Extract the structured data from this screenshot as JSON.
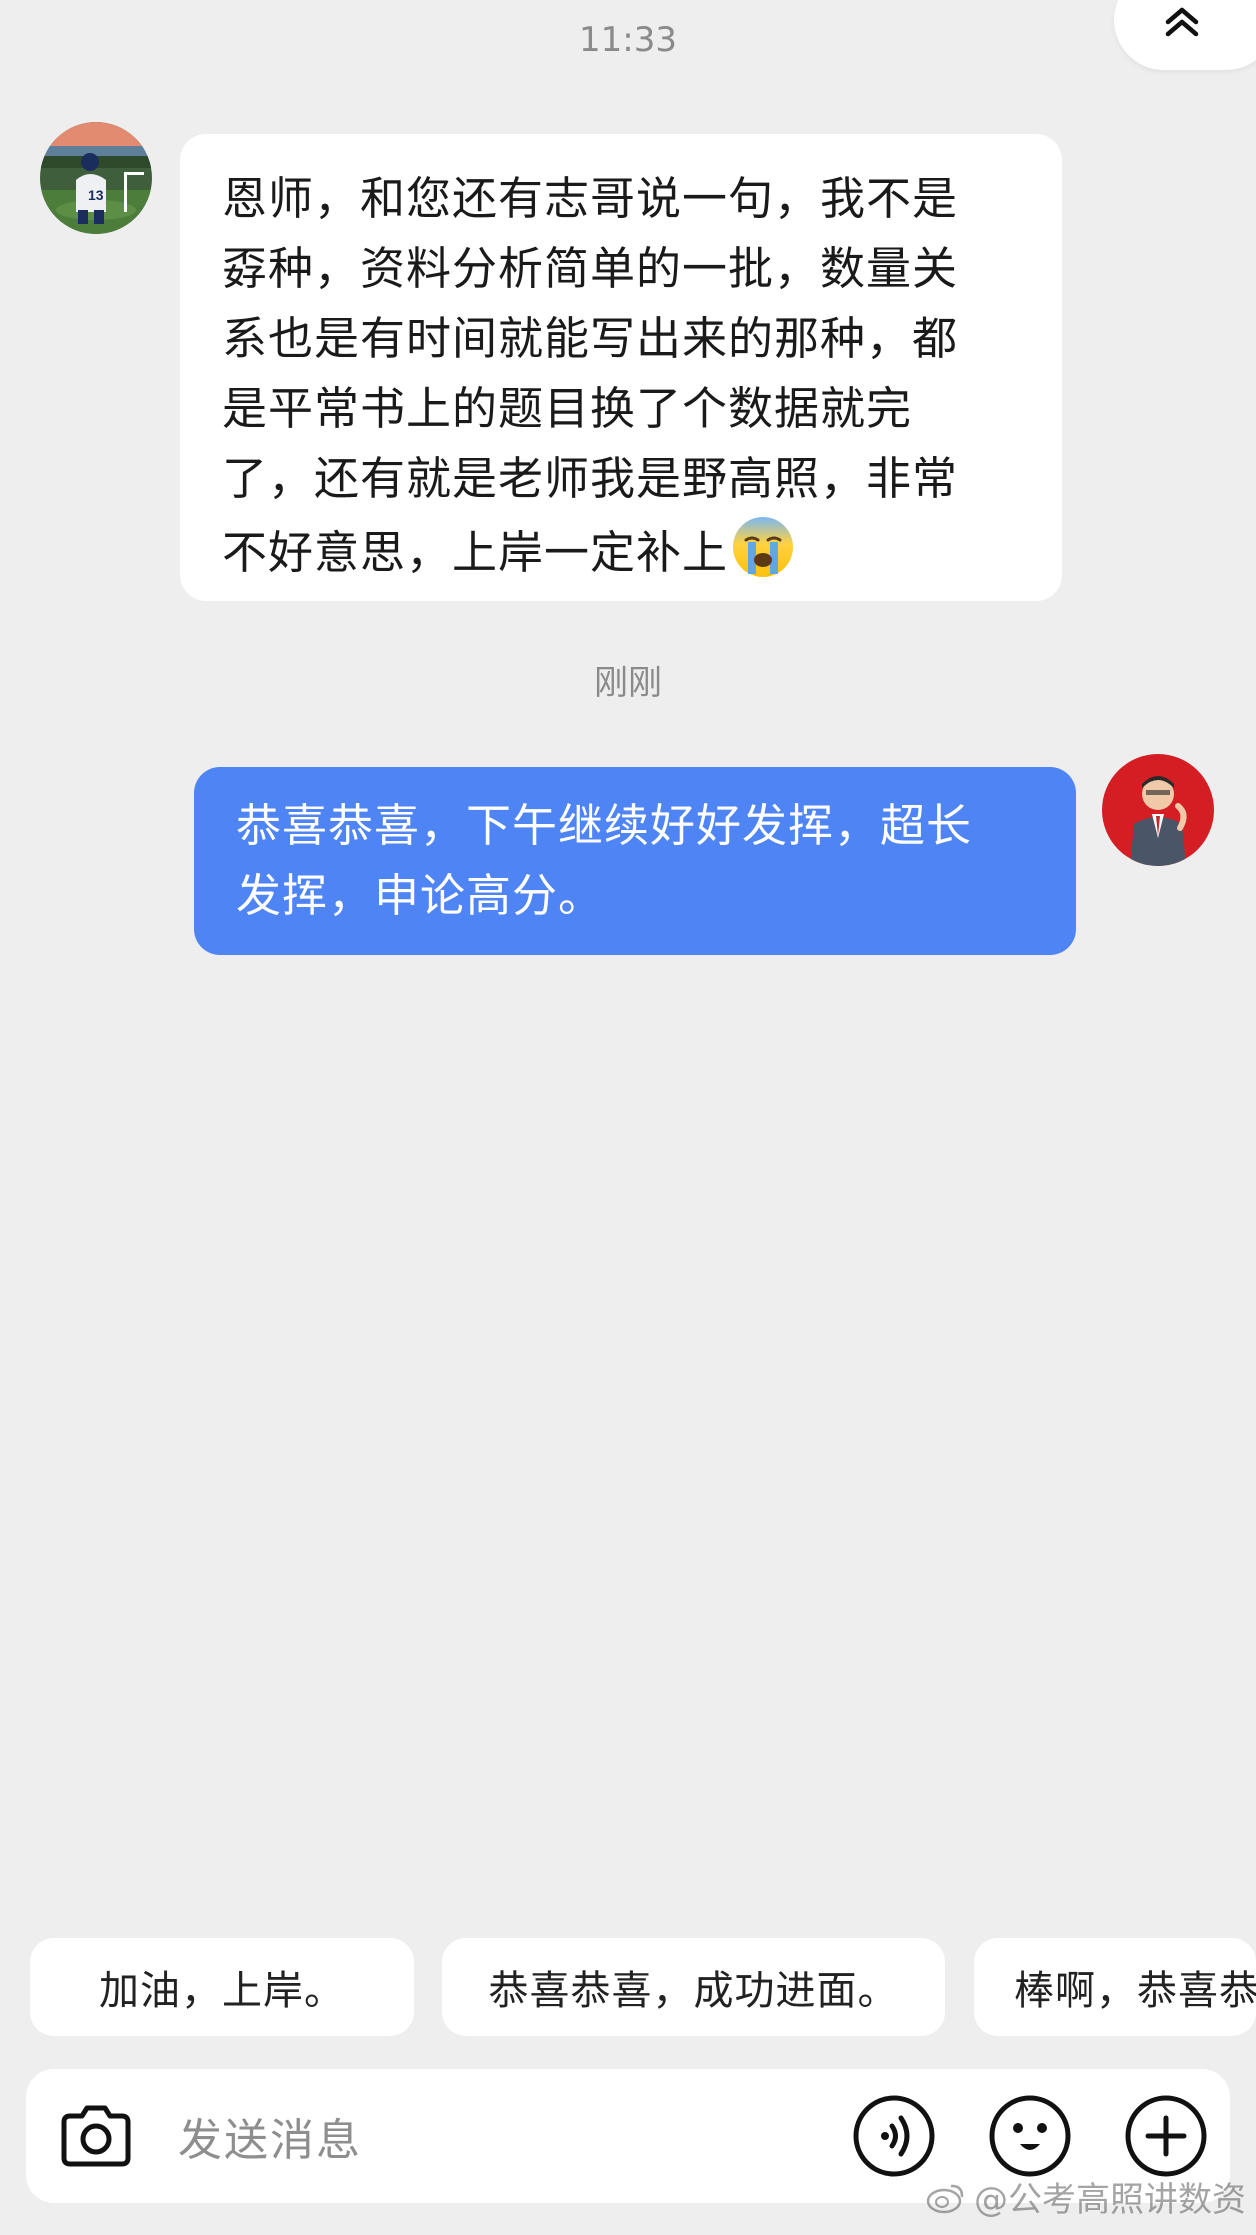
{
  "chat": {
    "top_time": "11:33",
    "middle_time": "刚刚"
  },
  "messages": [
    {
      "sender": "student",
      "lines": [
        "恩师，和您还有志哥说一句，我不是",
        "孬种，资料分析简单的一批，数量关",
        "系也是有时间就能写出来的那种，都",
        "是平常书上的题目换了个数据就完",
        "了，还有就是老师我是野高照，非常",
        "不好意思，上岸一定补上"
      ],
      "trailing_emoji": "crying-face"
    },
    {
      "sender": "teacher",
      "lines": [
        "恭喜恭喜，下午继续好好发挥，超长",
        "发挥，申论高分。"
      ]
    }
  ],
  "quick_replies": [
    "加油，上岸。",
    "恭喜恭喜，成功进面。",
    "棒啊，恭喜恭"
  ],
  "input": {
    "placeholder": "发送消息"
  },
  "icons": {
    "collapse": "double-chevron-up-icon",
    "camera": "camera-icon",
    "voice": "voice-icon",
    "emoji": "emoji-icon",
    "plus": "plus-icon"
  },
  "watermark": "@公考高照讲数资",
  "colors": {
    "background": "#eeeeee",
    "outgoing_bubble": "#4f84f5",
    "incoming_bubble": "#ffffff"
  }
}
